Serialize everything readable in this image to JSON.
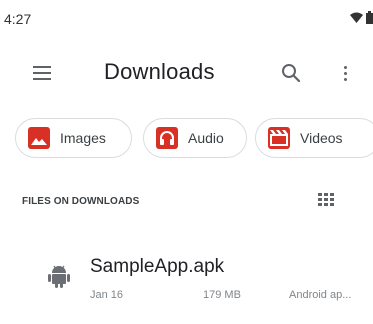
{
  "status_bar": {
    "time": "4:27"
  },
  "app_bar": {
    "title": "Downloads"
  },
  "chips": [
    {
      "label": "Images",
      "icon": "image-icon"
    },
    {
      "label": "Audio",
      "icon": "headphones-icon"
    },
    {
      "label": "Videos",
      "icon": "film-icon"
    }
  ],
  "section": {
    "header": "FILES ON DOWNLOADS"
  },
  "files": [
    {
      "name": "SampleApp.apk",
      "date": "Jan 16",
      "size": "179 MB",
      "type": "Android ap...",
      "icon": "android-icon"
    }
  ],
  "colors": {
    "chip_icon": "#d93025",
    "android": "#6b6f73",
    "text_primary": "#202124",
    "text_secondary": "#80868b"
  }
}
